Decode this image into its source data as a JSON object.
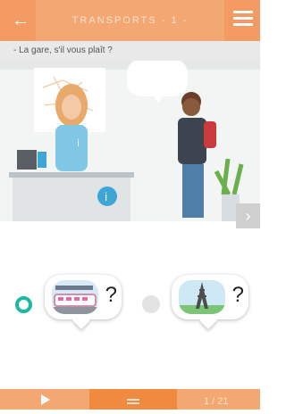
{
  "header": {
    "title": "TRANSPORTS - 1 -"
  },
  "prompt": {
    "text": "- La gare, s'il vous plaît ?"
  },
  "choices": [
    {
      "icon": "train-station-icon",
      "mark": "?",
      "selected": true
    },
    {
      "icon": "eiffel-tower-icon",
      "mark": "?",
      "selected": false
    }
  ],
  "footer": {
    "counter": "1 / 21"
  },
  "colors": {
    "accent": "#f39b62",
    "accent_dark": "#f08a3e",
    "selected": "#20b7a2"
  }
}
